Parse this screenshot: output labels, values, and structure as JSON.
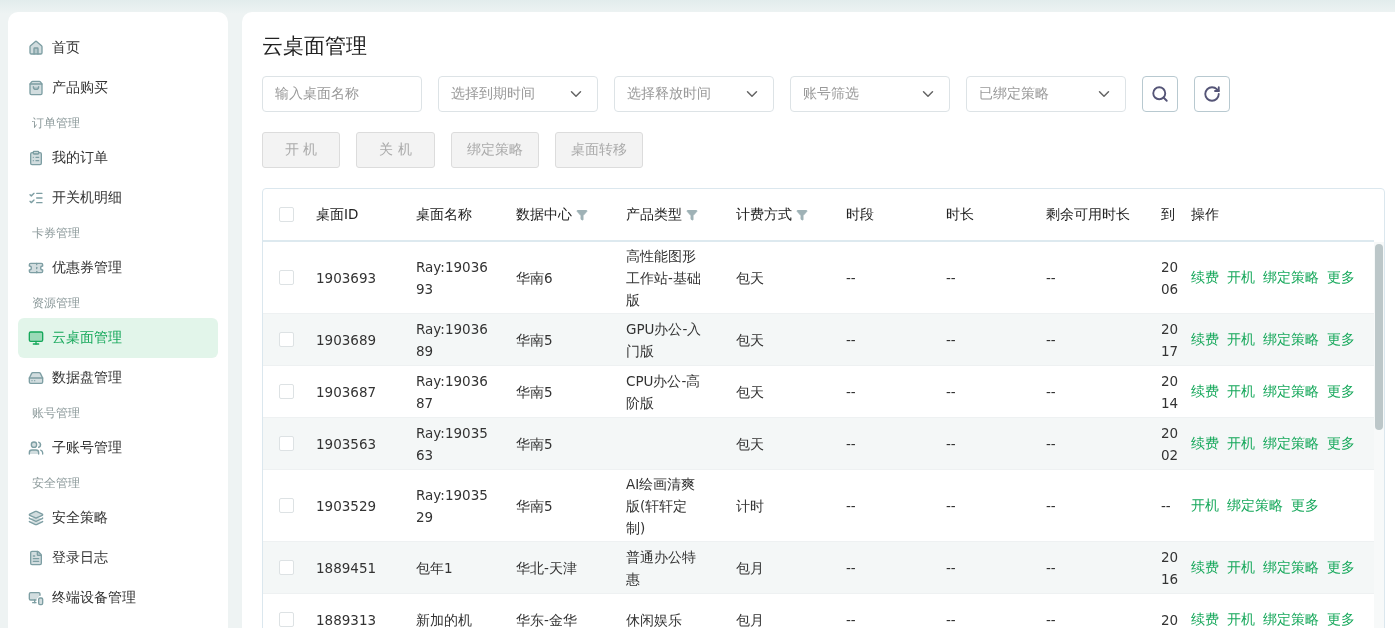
{
  "sidebar": {
    "items": [
      {
        "kind": "item",
        "label": "首页",
        "selected": false
      },
      {
        "kind": "item",
        "label": "产品购买",
        "selected": false
      },
      {
        "kind": "group",
        "label": "订单管理"
      },
      {
        "kind": "item",
        "label": "我的订单",
        "selected": false
      },
      {
        "kind": "item",
        "label": "开关机明细",
        "selected": false
      },
      {
        "kind": "group",
        "label": "卡券管理"
      },
      {
        "kind": "item",
        "label": "优惠券管理",
        "selected": false
      },
      {
        "kind": "group",
        "label": "资源管理"
      },
      {
        "kind": "item",
        "label": "云桌面管理",
        "selected": true
      },
      {
        "kind": "item",
        "label": "数据盘管理",
        "selected": false
      },
      {
        "kind": "group",
        "label": "账号管理"
      },
      {
        "kind": "item",
        "label": "子账号管理",
        "selected": false
      },
      {
        "kind": "group",
        "label": "安全管理"
      },
      {
        "kind": "item",
        "label": "安全策略",
        "selected": false
      },
      {
        "kind": "item",
        "label": "登录日志",
        "selected": false
      },
      {
        "kind": "item",
        "label": "终端设备管理",
        "selected": false
      }
    ]
  },
  "page_title": "云桌面管理",
  "filters": [
    {
      "kind": "input",
      "placeholder": "输入桌面名称"
    },
    {
      "kind": "select",
      "placeholder": "选择到期时间"
    },
    {
      "kind": "select",
      "placeholder": "选择释放时间"
    },
    {
      "kind": "select",
      "placeholder": "账号筛选"
    },
    {
      "kind": "select",
      "placeholder": "已绑定策略"
    }
  ],
  "actions": [
    {
      "label": "开 机",
      "disabled": true
    },
    {
      "label": "关 机",
      "disabled": true
    },
    {
      "label": "绑定策略",
      "disabled": true
    },
    {
      "label": "桌面转移",
      "disabled": true
    }
  ],
  "table": {
    "select_all_checked": false,
    "columns": [
      {
        "label": "桌面ID",
        "filter": false
      },
      {
        "label": "桌面名称",
        "filter": false
      },
      {
        "label": "数据中心",
        "filter": true
      },
      {
        "label": "产品类型",
        "filter": true
      },
      {
        "label": "计费方式",
        "filter": true
      },
      {
        "label": "时段",
        "filter": false
      },
      {
        "label": "时长",
        "filter": false
      },
      {
        "label": "剩余可用时长",
        "filter": false
      },
      {
        "label": "到",
        "filter": false
      },
      {
        "label": "操作",
        "filter": false
      }
    ],
    "rows": [
      {
        "checked": false,
        "cells": [
          "1903693",
          [
            "Ray:19036",
            "93"
          ],
          "华南6",
          [
            "高性能图形",
            "工作站-基础",
            "版"
          ],
          "包天",
          "--",
          "--",
          "--",
          [
            "20",
            "06"
          ]
        ],
        "actions": [
          "续费",
          "开机",
          "绑定策略",
          "更多"
        ]
      },
      {
        "checked": false,
        "cells": [
          "1903689",
          [
            "Ray:19036",
            "89"
          ],
          "华南5",
          [
            "GPU办公-入",
            "门版"
          ],
          "包天",
          "--",
          "--",
          "--",
          [
            "20",
            "17"
          ]
        ],
        "actions": [
          "续费",
          "开机",
          "绑定策略",
          "更多"
        ]
      },
      {
        "checked": false,
        "cells": [
          "1903687",
          [
            "Ray:19036",
            "87"
          ],
          "华南5",
          [
            "CPU办公-高",
            "阶版"
          ],
          "包天",
          "--",
          "--",
          "--",
          [
            "20",
            "14"
          ]
        ],
        "actions": [
          "续费",
          "开机",
          "绑定策略",
          "更多"
        ]
      },
      {
        "checked": false,
        "cells": [
          "1903563",
          [
            "Ray:19035",
            "63"
          ],
          "华南5",
          [],
          "包天",
          "--",
          "--",
          "--",
          [
            "20",
            "02"
          ]
        ],
        "actions": [
          "续费",
          "开机",
          "绑定策略",
          "更多"
        ]
      },
      {
        "checked": false,
        "cells": [
          "1903529",
          [
            "Ray:19035",
            "29"
          ],
          "华南5",
          [
            "AI绘画清爽",
            "版(轩轩定",
            "制)"
          ],
          "计时",
          "--",
          "--",
          "--",
          [
            "--"
          ]
        ],
        "actions": [
          "开机",
          "绑定策略",
          "更多"
        ]
      },
      {
        "checked": false,
        "cells": [
          "1889451",
          [
            "包年1"
          ],
          "华北-天津",
          [
            "普通办公特",
            "惠"
          ],
          "包月",
          "--",
          "--",
          "--",
          [
            "20",
            "16"
          ]
        ],
        "actions": [
          "续费",
          "开机",
          "绑定策略",
          "更多"
        ]
      },
      {
        "checked": false,
        "cells": [
          "1889313",
          [
            "新加的机"
          ],
          "华东-金华",
          [
            "休闲娱乐"
          ],
          "包月",
          "--",
          "--",
          "--",
          [
            "20"
          ]
        ],
        "actions": [
          "续费",
          "开机",
          "绑定策略",
          "更多"
        ]
      }
    ]
  }
}
